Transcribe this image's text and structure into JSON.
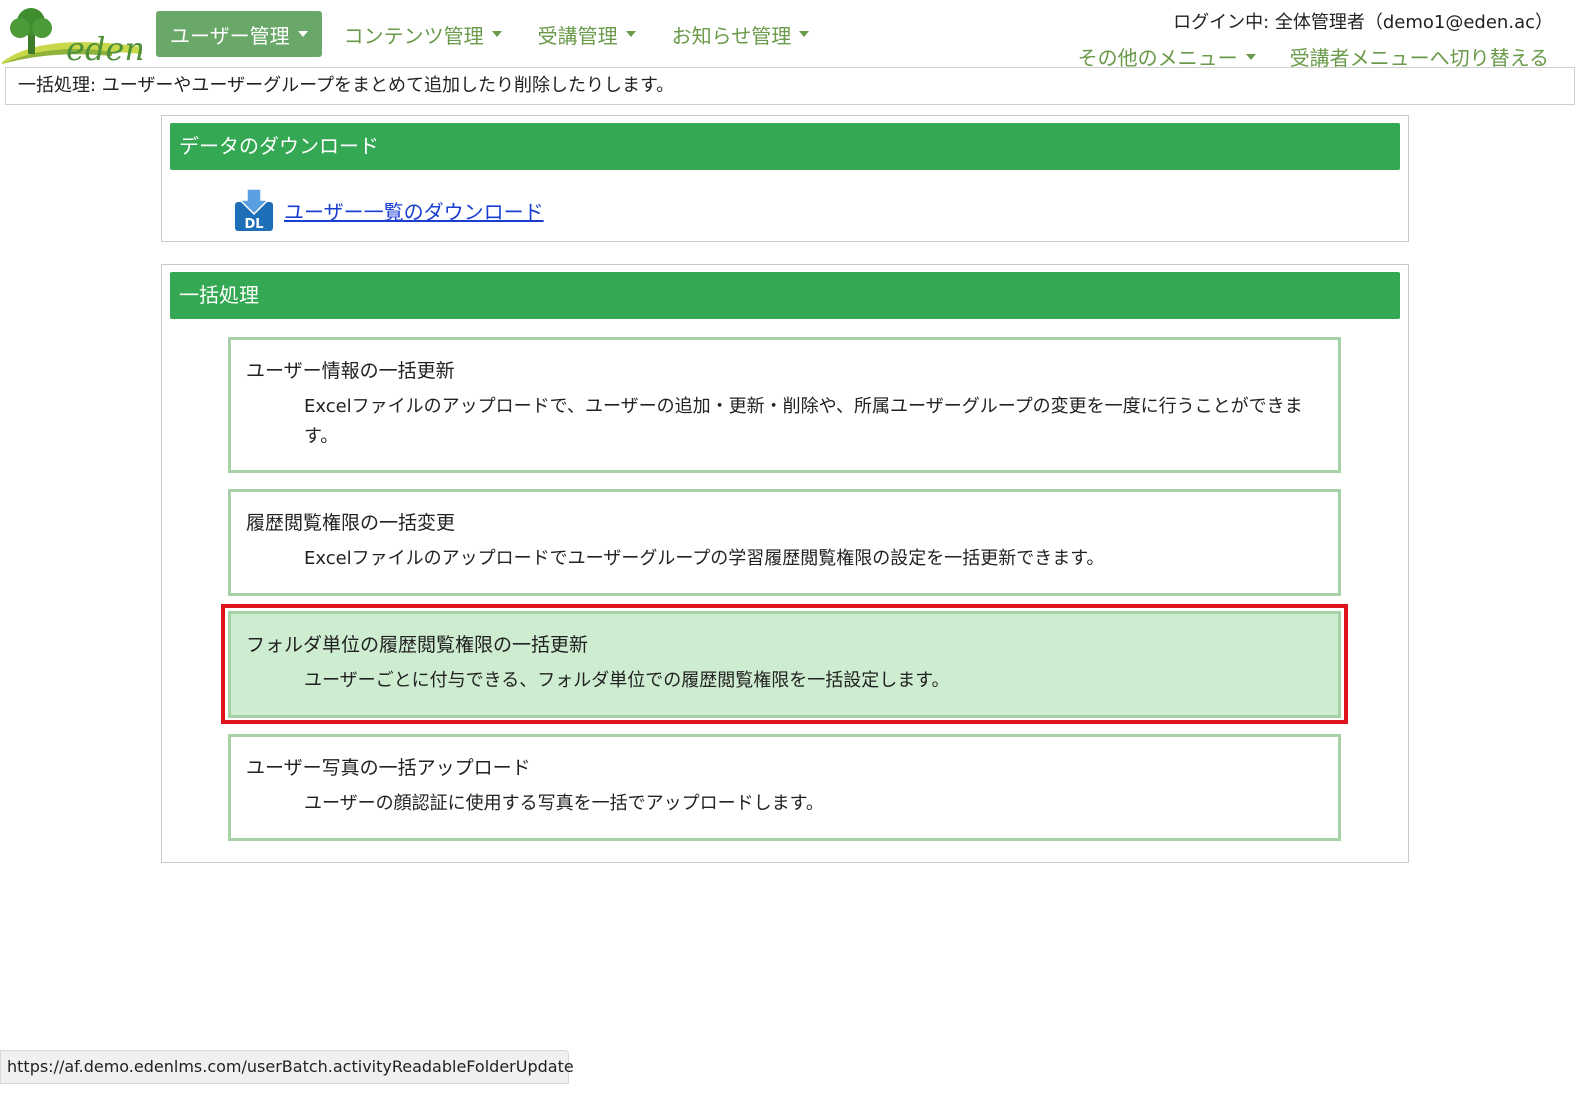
{
  "header": {
    "logo_text": "eden",
    "nav": [
      {
        "label": "ユーザー管理",
        "active": true
      },
      {
        "label": "コンテンツ管理",
        "active": false
      },
      {
        "label": "受講管理",
        "active": false
      },
      {
        "label": "お知らせ管理",
        "active": false
      }
    ],
    "login_info": "ログイン中: 全体管理者（demo1@eden.ac）",
    "sub_nav": {
      "other_menu": "その他のメニュー",
      "switch_menu": "受講者メニューへ切り替える"
    }
  },
  "description": "一括処理: ユーザーやユーザーグループをまとめて追加したり削除したりします。",
  "download_panel": {
    "title": "データのダウンロード",
    "icon_label": "DL",
    "link": "ユーザー一覧のダウンロード"
  },
  "batch_panel": {
    "title": "一括処理",
    "cards": [
      {
        "title": "ユーザー情報の一括更新",
        "desc": "Excelファイルのアップロードで、ユーザーの追加・更新・削除や、所属ユーザーグループの変更を一度に行うことができます。"
      },
      {
        "title": "履歴閲覧権限の一括変更",
        "desc": "Excelファイルのアップロードでユーザーグループの学習履歴閲覧権限の設定を一括更新できます。"
      },
      {
        "title": "フォルダ単位の履歴閲覧権限の一括更新",
        "desc": "ユーザーごとに付与できる、フォルダ単位での履歴閲覧権限を一括設定します。"
      },
      {
        "title": "ユーザー写真の一括アップロード",
        "desc": "ユーザーの顔認証に使用する写真を一括でアップロードします。"
      }
    ]
  },
  "status_url": "https://af.demo.edenlms.com/userBatch.activityReadableFolderUpdate",
  "colors": {
    "accent": "#34a853",
    "nav_text": "#6a9a4a",
    "highlight": "#e0141b"
  }
}
